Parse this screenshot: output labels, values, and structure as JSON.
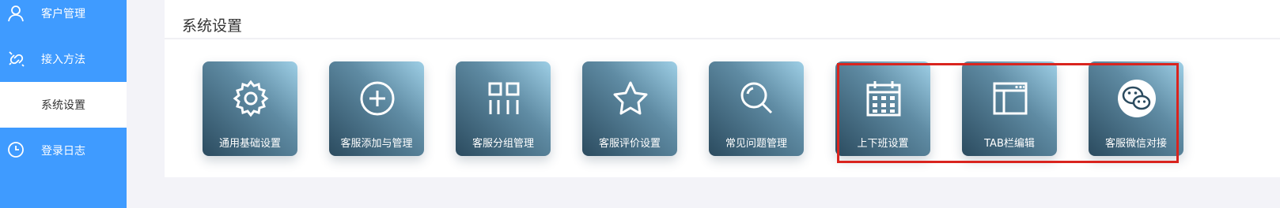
{
  "sidebar": {
    "items": [
      {
        "label": "客户管理",
        "icon": "user-icon"
      },
      {
        "label": "接入方法",
        "icon": "link-icon"
      },
      {
        "label": "系统设置",
        "icon": ""
      },
      {
        "label": "登录日志",
        "icon": "clock-icon"
      }
    ]
  },
  "page": {
    "title": "系统设置"
  },
  "tiles": [
    {
      "label": "通用基础设置",
      "icon": "gear-icon"
    },
    {
      "label": "客服添加与管理",
      "icon": "plus-circle-icon"
    },
    {
      "label": "客服分组管理",
      "icon": "grid-icon"
    },
    {
      "label": "客服评价设置",
      "icon": "star-icon"
    },
    {
      "label": "常见问题管理",
      "icon": "search-icon"
    },
    {
      "label": "上下班设置",
      "icon": "calendar-icon"
    },
    {
      "label": "TAB栏编辑",
      "icon": "window-icon"
    },
    {
      "label": "客服微信对接",
      "icon": "wechat-icon"
    }
  ],
  "colors": {
    "sidebar": "#3f9bff",
    "highlight": "#d9241e",
    "tile_dark": "#2b4b5f",
    "tile_light": "#9ecfe6"
  }
}
